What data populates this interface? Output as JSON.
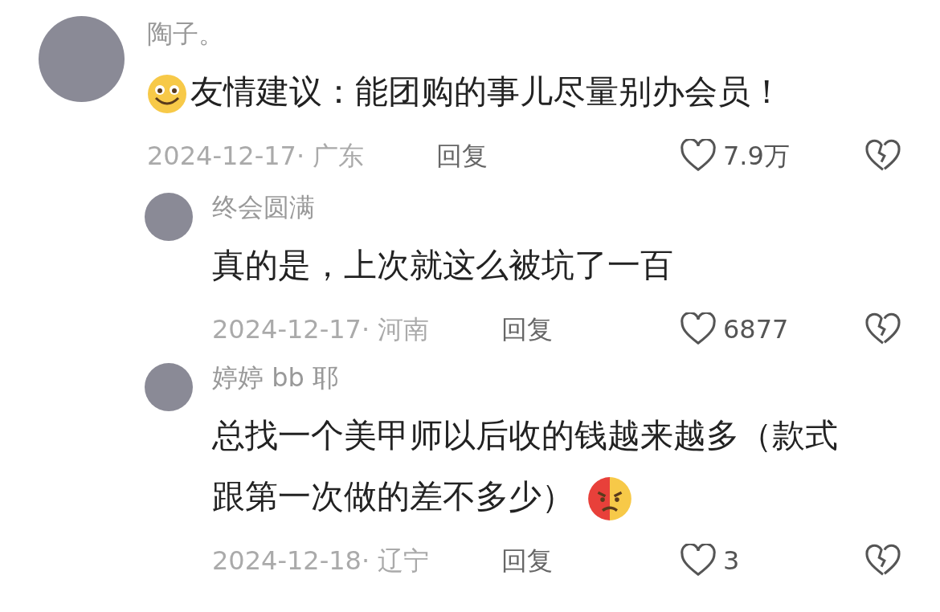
{
  "comments": [
    {
      "user": "陶子。",
      "content": [
        {
          "kind": "smiling_emoji"
        },
        {
          "kind": "text",
          "text": "友情建议：能团购的事儿尽量别办会员！"
        }
      ],
      "date_location": "2024-12-17· 广东",
      "reply_label": "回复",
      "likes": "7.9万",
      "liked": false,
      "replies": [
        {
          "user": "终会圆满",
          "content": [
            {
              "kind": "text",
              "text": "真的是，上次就这么被坑了一百"
            }
          ],
          "date_location": "2024-12-17· 河南",
          "reply_label": "回复",
          "likes": "6877",
          "liked": false
        },
        {
          "user": "婷婷 bb 耶",
          "content": [
            {
              "kind": "text",
              "text": "总找一个美甲师以后收的钱越来越多（款式跟第一次做的差不多少）"
            },
            {
              "kind": "annoyed_emoji"
            }
          ],
          "date_location": "2024-12-18· 辽宁",
          "reply_label": "回复",
          "likes": "3",
          "liked": false
        }
      ]
    }
  ]
}
